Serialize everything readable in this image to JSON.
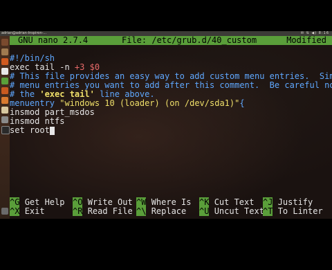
{
  "window": {
    "title": "adrian@adrian-Inspiron-...",
    "tray": "✉ ⇅ ◀) 8:16"
  },
  "nano": {
    "version": "GNU nano 2.7.4",
    "file": "File: /etc/grub.d/40_custom",
    "status": "Modified"
  },
  "buffer": {
    "line1": "#!/bin/sh",
    "line2": {
      "cmd": "exec tail -n ",
      "num": "+3",
      "var": " $0"
    },
    "line3": {
      "text": "# This file provides an easy way to add custom menu entries.  Simply ",
      "trunc": "$"
    },
    "line4": {
      "text": "# menu entries you want to add after this comment.  Be careful not to",
      "trunc": "$"
    },
    "line5": {
      "pre": "# the ",
      "quoted": "'exec tail'",
      "post": " line above."
    },
    "line6": {
      "cmd": "menuentry ",
      "str": "\"windows 10 (loader) (on /dev/sda1)\"",
      "brace": "{"
    },
    "line7": "insmod part_msdos",
    "line8": "insmod ntfs",
    "line9": "set root"
  },
  "shortcuts": {
    "row1": [
      {
        "key": "^G",
        "label": "Get Help"
      },
      {
        "key": "^O",
        "label": "Write Out"
      },
      {
        "key": "^W",
        "label": "Where Is"
      },
      {
        "key": "^K",
        "label": "Cut Text"
      },
      {
        "key": "^J",
        "label": "Justify"
      }
    ],
    "row2": [
      {
        "key": "^X",
        "label": "Exit"
      },
      {
        "key": "^R",
        "label": "Read File"
      },
      {
        "key": "^\\",
        "label": "Replace"
      },
      {
        "key": "^U",
        "label": "Uncut Text"
      },
      {
        "key": "^T",
        "label": "To Linter"
      }
    ]
  },
  "colors": {
    "accent": "#5a9e3a",
    "comment": "#5fa8ff",
    "string": "#f0e06a",
    "number": "#e86a6a"
  }
}
